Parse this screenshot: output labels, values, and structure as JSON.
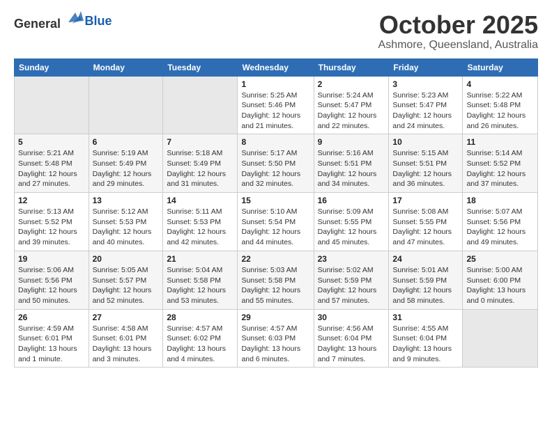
{
  "logo": {
    "general": "General",
    "blue": "Blue"
  },
  "header": {
    "month": "October 2025",
    "location": "Ashmore, Queensland, Australia"
  },
  "weekdays": [
    "Sunday",
    "Monday",
    "Tuesday",
    "Wednesday",
    "Thursday",
    "Friday",
    "Saturday"
  ],
  "weeks": [
    [
      {
        "day": "",
        "info": ""
      },
      {
        "day": "",
        "info": ""
      },
      {
        "day": "",
        "info": ""
      },
      {
        "day": "1",
        "info": "Sunrise: 5:25 AM\nSunset: 5:46 PM\nDaylight: 12 hours\nand 21 minutes."
      },
      {
        "day": "2",
        "info": "Sunrise: 5:24 AM\nSunset: 5:47 PM\nDaylight: 12 hours\nand 22 minutes."
      },
      {
        "day": "3",
        "info": "Sunrise: 5:23 AM\nSunset: 5:47 PM\nDaylight: 12 hours\nand 24 minutes."
      },
      {
        "day": "4",
        "info": "Sunrise: 5:22 AM\nSunset: 5:48 PM\nDaylight: 12 hours\nand 26 minutes."
      }
    ],
    [
      {
        "day": "5",
        "info": "Sunrise: 5:21 AM\nSunset: 5:48 PM\nDaylight: 12 hours\nand 27 minutes."
      },
      {
        "day": "6",
        "info": "Sunrise: 5:19 AM\nSunset: 5:49 PM\nDaylight: 12 hours\nand 29 minutes."
      },
      {
        "day": "7",
        "info": "Sunrise: 5:18 AM\nSunset: 5:49 PM\nDaylight: 12 hours\nand 31 minutes."
      },
      {
        "day": "8",
        "info": "Sunrise: 5:17 AM\nSunset: 5:50 PM\nDaylight: 12 hours\nand 32 minutes."
      },
      {
        "day": "9",
        "info": "Sunrise: 5:16 AM\nSunset: 5:51 PM\nDaylight: 12 hours\nand 34 minutes."
      },
      {
        "day": "10",
        "info": "Sunrise: 5:15 AM\nSunset: 5:51 PM\nDaylight: 12 hours\nand 36 minutes."
      },
      {
        "day": "11",
        "info": "Sunrise: 5:14 AM\nSunset: 5:52 PM\nDaylight: 12 hours\nand 37 minutes."
      }
    ],
    [
      {
        "day": "12",
        "info": "Sunrise: 5:13 AM\nSunset: 5:52 PM\nDaylight: 12 hours\nand 39 minutes."
      },
      {
        "day": "13",
        "info": "Sunrise: 5:12 AM\nSunset: 5:53 PM\nDaylight: 12 hours\nand 40 minutes."
      },
      {
        "day": "14",
        "info": "Sunrise: 5:11 AM\nSunset: 5:53 PM\nDaylight: 12 hours\nand 42 minutes."
      },
      {
        "day": "15",
        "info": "Sunrise: 5:10 AM\nSunset: 5:54 PM\nDaylight: 12 hours\nand 44 minutes."
      },
      {
        "day": "16",
        "info": "Sunrise: 5:09 AM\nSunset: 5:55 PM\nDaylight: 12 hours\nand 45 minutes."
      },
      {
        "day": "17",
        "info": "Sunrise: 5:08 AM\nSunset: 5:55 PM\nDaylight: 12 hours\nand 47 minutes."
      },
      {
        "day": "18",
        "info": "Sunrise: 5:07 AM\nSunset: 5:56 PM\nDaylight: 12 hours\nand 49 minutes."
      }
    ],
    [
      {
        "day": "19",
        "info": "Sunrise: 5:06 AM\nSunset: 5:56 PM\nDaylight: 12 hours\nand 50 minutes."
      },
      {
        "day": "20",
        "info": "Sunrise: 5:05 AM\nSunset: 5:57 PM\nDaylight: 12 hours\nand 52 minutes."
      },
      {
        "day": "21",
        "info": "Sunrise: 5:04 AM\nSunset: 5:58 PM\nDaylight: 12 hours\nand 53 minutes."
      },
      {
        "day": "22",
        "info": "Sunrise: 5:03 AM\nSunset: 5:58 PM\nDaylight: 12 hours\nand 55 minutes."
      },
      {
        "day": "23",
        "info": "Sunrise: 5:02 AM\nSunset: 5:59 PM\nDaylight: 12 hours\nand 57 minutes."
      },
      {
        "day": "24",
        "info": "Sunrise: 5:01 AM\nSunset: 5:59 PM\nDaylight: 12 hours\nand 58 minutes."
      },
      {
        "day": "25",
        "info": "Sunrise: 5:00 AM\nSunset: 6:00 PM\nDaylight: 13 hours\nand 0 minutes."
      }
    ],
    [
      {
        "day": "26",
        "info": "Sunrise: 4:59 AM\nSunset: 6:01 PM\nDaylight: 13 hours\nand 1 minute."
      },
      {
        "day": "27",
        "info": "Sunrise: 4:58 AM\nSunset: 6:01 PM\nDaylight: 13 hours\nand 3 minutes."
      },
      {
        "day": "28",
        "info": "Sunrise: 4:57 AM\nSunset: 6:02 PM\nDaylight: 13 hours\nand 4 minutes."
      },
      {
        "day": "29",
        "info": "Sunrise: 4:57 AM\nSunset: 6:03 PM\nDaylight: 13 hours\nand 6 minutes."
      },
      {
        "day": "30",
        "info": "Sunrise: 4:56 AM\nSunset: 6:04 PM\nDaylight: 13 hours\nand 7 minutes."
      },
      {
        "day": "31",
        "info": "Sunrise: 4:55 AM\nSunset: 6:04 PM\nDaylight: 13 hours\nand 9 minutes."
      },
      {
        "day": "",
        "info": ""
      }
    ]
  ]
}
